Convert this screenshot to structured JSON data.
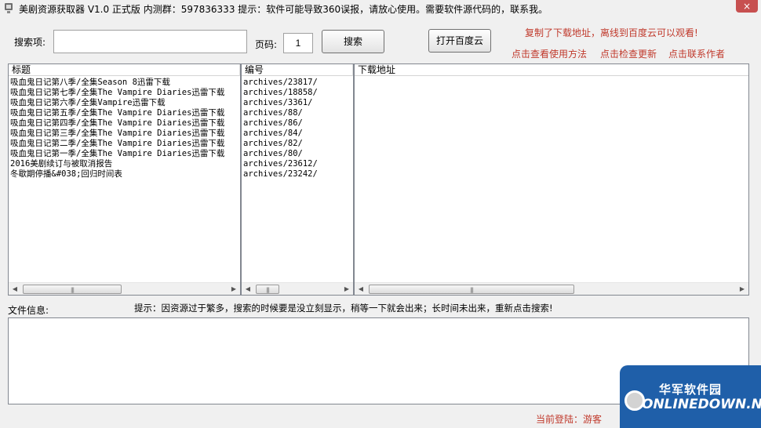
{
  "window": {
    "title": "美剧资源获取器 V1.0 正式版   内测群：597836333    提示：软件可能导致360误报，请放心使用。需要软件源代码的，联系我。",
    "close_label": "×"
  },
  "search": {
    "label": "搜索项:",
    "value": "",
    "page_label": "页码:",
    "page_value": "1",
    "search_button": "搜索",
    "open_baidu_button": "打开百度云"
  },
  "notice": {
    "top": "复制了下载地址，离线到百度云可以观看!",
    "link_usage": "点击查看使用方法",
    "link_update": "点击检查更新",
    "link_author": "点击联系作者"
  },
  "titles_pane": {
    "header": "标题",
    "rows": [
      "吸血鬼日记第八季/全集Season 8迅雷下载",
      "吸血鬼日记第七季/全集The Vampire Diaries迅雷下载",
      "吸血鬼日记第六季/全集Vampire迅雷下载",
      "吸血鬼日记第五季/全集The Vampire Diaries迅雷下载",
      "吸血鬼日记第四季/全集The Vampire Diaries迅雷下载",
      "吸血鬼日记第三季/全集The Vampire Diaries迅雷下载",
      "吸血鬼日记第二季/全集The Vampire Diaries迅雷下载",
      "吸血鬼日记第一季/全集The Vampire Diaries迅雷下载",
      "2016美剧续订与被取消报告",
      "冬歇期停播&#038;回归时间表"
    ]
  },
  "ids_pane": {
    "header": "编号",
    "rows": [
      "archives/23817/",
      "archives/18858/",
      "archives/3361/",
      "archives/88/",
      "archives/86/",
      "archives/84/",
      "archives/82/",
      "archives/80/",
      "archives/23612/",
      "archives/23242/"
    ]
  },
  "download_pane": {
    "header": "下载地址",
    "rows": []
  },
  "info": {
    "label": "文件信息:",
    "hint": "提示：因资源过于繁多，搜索的时候要是没立刻显示，稍等一下就会出来；长时间未出来，重新点击搜索!",
    "value": ""
  },
  "status": {
    "login": "当前登陆：游客"
  },
  "watermark": {
    "cn": "华军软件园",
    "en": "ONLINEDOWN.NET"
  },
  "colors": {
    "notice_red": "#c0392b",
    "watermark_blue": "#1f5fa9"
  }
}
